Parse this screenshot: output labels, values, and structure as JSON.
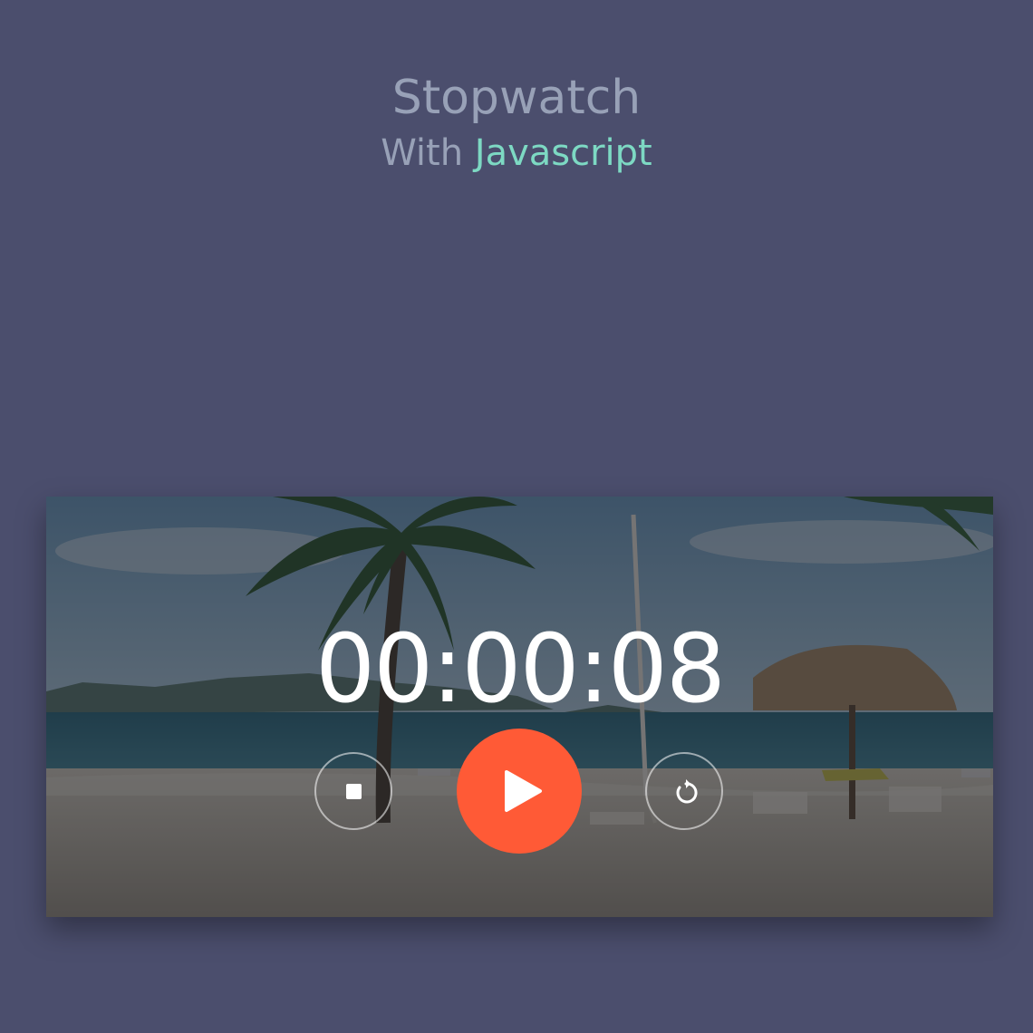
{
  "header": {
    "title": "Stopwatch",
    "subtitle_prefix": "With",
    "subtitle_accent": "Javascript"
  },
  "stopwatch": {
    "time": "00:00:08"
  },
  "controls": {
    "stop_icon": "stop-icon",
    "play_icon": "play-icon",
    "reset_icon": "reset-icon"
  },
  "colors": {
    "background": "#4b4e6d",
    "title": "#98a1b7",
    "accent": "#7dd9c3",
    "play_button": "#ff5a36"
  }
}
